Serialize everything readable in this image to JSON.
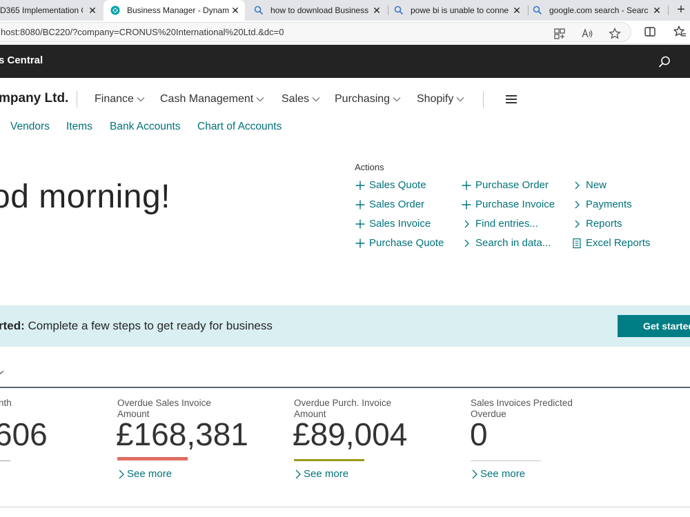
{
  "browser": {
    "tabs": [
      {
        "title": "D365 Implementation C",
        "active": false,
        "icon": "page-icon"
      },
      {
        "title": "Business Manager - Dynam",
        "active": true,
        "icon": "dynamics-icon"
      },
      {
        "title": "how to download Business",
        "active": false,
        "icon": "search-icon"
      },
      {
        "title": "powe bi is unable to conne",
        "active": false,
        "icon": "search-icon"
      },
      {
        "title": "google.com search - Searc",
        "active": false,
        "icon": "search-icon"
      }
    ],
    "close_glyph": "✕",
    "new_tab_glyph": "+",
    "url": "host:8080/BC220/?company=CRONUS%20International%20Ltd.&dc=0"
  },
  "app": {
    "title": "s Central",
    "company": "mpany Ltd.",
    "menus": [
      "Finance",
      "Cash Management",
      "Sales",
      "Purchasing",
      "Shopify"
    ],
    "quicklinks": [
      "Vendors",
      "Items",
      "Bank Accounts",
      "Chart of Accounts"
    ]
  },
  "main": {
    "greeting": "od morning!",
    "actions_label": "Actions",
    "actions": {
      "col1": [
        "Sales Quote",
        "Sales Order",
        "Sales Invoice",
        "Purchase Quote"
      ],
      "col2": [
        "Purchase Order",
        "Purchase Invoice",
        "Find entries...",
        "Search in data..."
      ],
      "col3": [
        "New",
        "Payments",
        "Reports",
        "Excel Reports"
      ]
    }
  },
  "banner": {
    "bold": "rted:",
    "text": " Complete a few steps to get ready for business",
    "button": "Get started"
  },
  "cues": [
    {
      "label": "nth",
      "value": "606",
      "bar_color": "#9e9e9e"
    },
    {
      "label": "Overdue Sales Invoice Amount",
      "value": "£168,381",
      "bar_color": "#e06c61"
    },
    {
      "label": "Overdue Purch. Invoice Amount",
      "value": "£89,004",
      "bar_color": "#9a9a1a"
    },
    {
      "label": "Sales Invoices Predicted Overdue",
      "value": "0",
      "bar_color": "#c8c8c8"
    }
  ],
  "see_more": "See more",
  "colors": {
    "accent": "#00727a",
    "header": "#232323",
    "banner": "#d9eff1",
    "button": "#007e85"
  }
}
